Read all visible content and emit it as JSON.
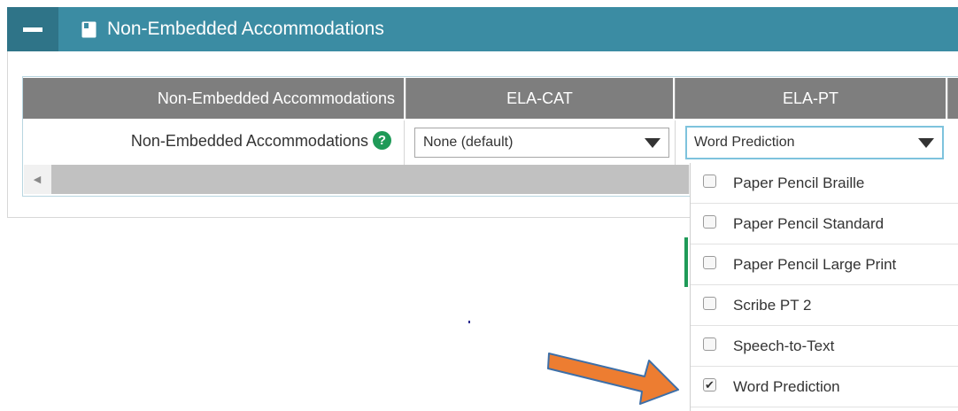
{
  "panel": {
    "title": "Non-Embedded Accommodations",
    "header_color": "#3b8ca3",
    "collapse_icon": "minus-icon",
    "title_icon": "document-icon"
  },
  "table": {
    "headers": [
      "Non-Embedded Accommodations",
      "ELA-CAT",
      "ELA-PT"
    ],
    "row": {
      "label": "Non-Embedded Accommodations",
      "help_glyph": "?",
      "help_icon": "question-circle-icon",
      "ela_cat_value": "None (default)",
      "ela_pt_value": "Word Prediction"
    }
  },
  "scrollbar": {
    "left_arrow_glyph": "◀"
  },
  "dropdown": {
    "options": [
      {
        "label": "Paper Pencil Braille",
        "checked": false
      },
      {
        "label": "Paper Pencil Standard",
        "checked": false
      },
      {
        "label": "Paper Pencil Large Print",
        "checked": false
      },
      {
        "label": "Scribe PT 2",
        "checked": false
      },
      {
        "label": "Speech-to-Text",
        "checked": false
      },
      {
        "label": "Word Prediction",
        "checked": true
      }
    ]
  },
  "annotation": {
    "arrow_icon": "arrow-right-icon",
    "arrow_color": "#ed7d31"
  }
}
